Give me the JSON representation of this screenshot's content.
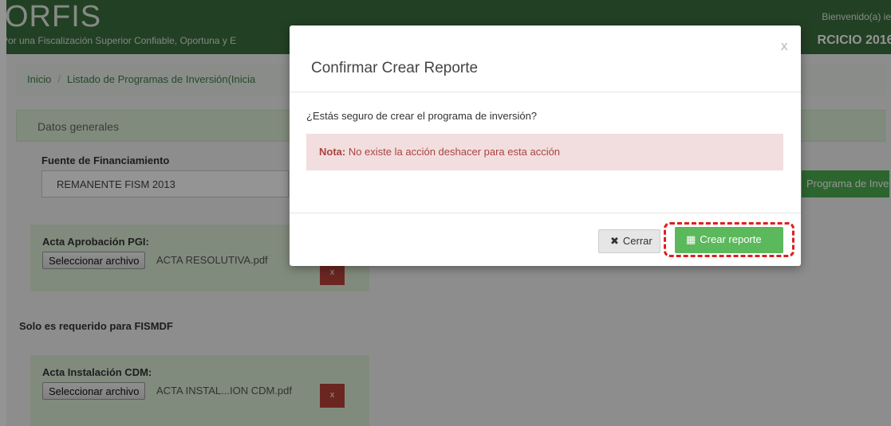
{
  "header": {
    "logo": "ORFIS",
    "tagline": "Por una Fiscalización Superior Confiable, Oportuna y E",
    "welcome": "Bienvenido(a) ie",
    "ejercicio": "RCICIO 2016."
  },
  "breadcrumb": {
    "items": [
      "Inicio",
      "Listado de Programas de Inversión(Inicia"
    ],
    "separator": "/"
  },
  "panel": {
    "title": "Datos generales",
    "fuente_label": "Fuente de Financiamiento",
    "fuente_value": "REMANENTE FISM 2013",
    "create_program_button": "Programa de Inve",
    "acta_pgi_label": "Acta Aprobación PGI:",
    "file_button_label": "Seleccionar archivo",
    "acta_pgi_file": "ACTA RESOLUTIVA.pdf",
    "delete_label": "x",
    "solo_note": "Solo es requerido para FISMDF",
    "acta_cdm_label": "Acta Instalación CDM:",
    "acta_cdm_file": "ACTA INSTAL...ION CDM.pdf"
  },
  "modal": {
    "title": "Confirmar Crear Reporte",
    "close_glyph": "x",
    "question": "¿Estás seguro de crear el programa de inversión?",
    "alert_strong": "Nota:",
    "alert_text": " No existe la acción deshacer para esta acción",
    "cancel_label": "Cerrar",
    "confirm_label": "Crear reporte"
  },
  "colors": {
    "header_green": "#3c6e3f",
    "panel_green": "#dff0d8",
    "button_green": "#5cb85c",
    "alert_bg": "#f2dede",
    "alert_text": "#a94442",
    "delete_red": "#b8423b",
    "highlight_red": "#dd1f1f"
  },
  "icons": {
    "cancel": "times-icon",
    "confirm": "file-plus-icon",
    "close": "close-icon"
  }
}
